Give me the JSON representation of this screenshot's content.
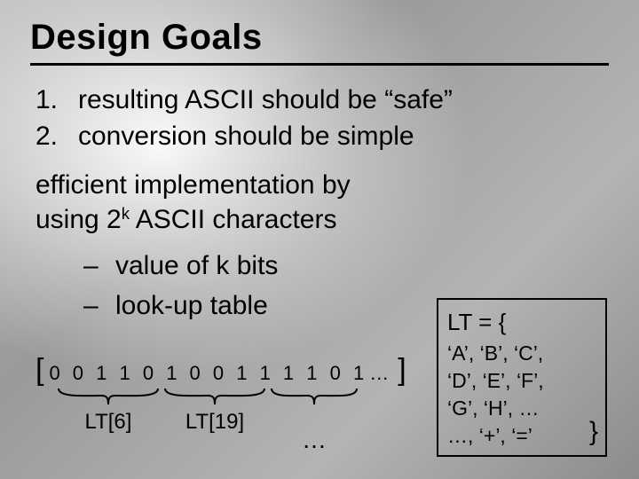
{
  "title": "Design Goals",
  "goals": [
    {
      "n": "1.",
      "text": "resulting ASCII should be “safe”"
    },
    {
      "n": "2.",
      "text": "conversion should be simple"
    }
  ],
  "impl_line1": "efficient implementation by",
  "impl_line2_pre": "using 2",
  "impl_line2_sup": "k",
  "impl_line2_post": " ASCII characters",
  "sub": [
    "value of k bits",
    "look-up table"
  ],
  "bits": {
    "open": "[",
    "close": "]",
    "digits": "0 0 1 1 0 1 0 0 1 1 1 1 0 1",
    "ellipsis": "…"
  },
  "brace_labels": {
    "a": "LT[6]",
    "b": "LT[19]",
    "c": "…"
  },
  "lt": {
    "head": "LT = {",
    "rows": [
      "‘A’, ‘B’, ‘C’,",
      "‘D’, ‘E’, ‘F’,",
      "‘G’, ‘H’, …",
      "…, ‘+’, ‘=’"
    ],
    "close": "}"
  }
}
